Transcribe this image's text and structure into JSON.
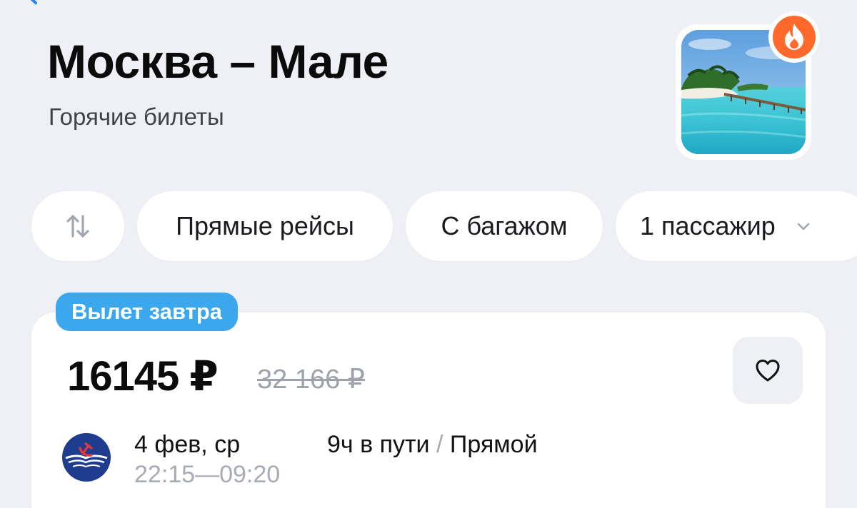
{
  "header": {
    "title": "Москва – Мале",
    "subtitle": "Горячие билеты"
  },
  "icons": {
    "back": "chevron-left-icon",
    "hot": "fire-icon",
    "sort": "sort-arrows-icon",
    "dropdown": "chevron-down-icon",
    "favorite": "heart-icon",
    "airline": "aeroflot-logo"
  },
  "filters": {
    "direct": "Прямые рейсы",
    "baggage": "С багажом",
    "passengers": "1 пассажир"
  },
  "ticket": {
    "tag": "Вылет завтра",
    "price": "16145 ₽",
    "old_price": "32 166 ₽",
    "date": "4 фев, ср",
    "departure": "22:15",
    "arrival": "09:20",
    "time_separator": "—",
    "duration": "9ч в пути",
    "separator": "/",
    "stops": "Прямой"
  },
  "colors": {
    "background": "#eef0f5",
    "tag": "#3ba8ee",
    "fire": "#ff6a2c",
    "back": "#2f7ff0"
  }
}
